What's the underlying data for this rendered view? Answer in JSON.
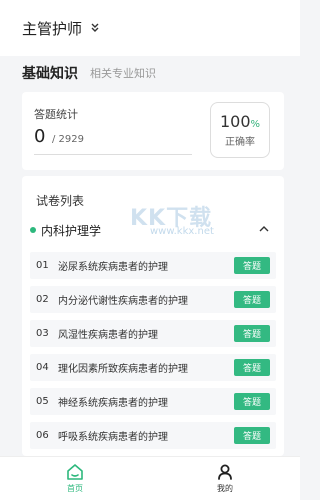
{
  "header": {
    "title": "主管护师",
    "dropdown_icon": "chevron-double-down-icon"
  },
  "tabs": {
    "active": "基础知识",
    "inactive": "相关专业知识"
  },
  "stats": {
    "label": "答题统计",
    "answered": "0",
    "total": "/ 2929",
    "rate_value": "100",
    "rate_unit": "%",
    "rate_label": "正确率"
  },
  "paper_list": {
    "title": "试卷列表",
    "category": "内科护理学",
    "category_expanded": true,
    "action_label": "答题",
    "items": [
      {
        "num": "01",
        "title": "泌尿系统疾病患者的护理"
      },
      {
        "num": "02",
        "title": "内分泌代谢性疾病患者的护理"
      },
      {
        "num": "03",
        "title": "风湿性疾病患者的护理"
      },
      {
        "num": "04",
        "title": "理化因素所致疾病患者的护理"
      },
      {
        "num": "05",
        "title": "神经系统疾病患者的护理"
      },
      {
        "num": "06",
        "title": "呼吸系统疾病患者的护理"
      }
    ]
  },
  "watermark": {
    "text": "KK下载",
    "url": "www.kkx.net"
  },
  "bottom_nav": {
    "home": "首页",
    "me": "我的"
  },
  "colors": {
    "accent": "#2db87d",
    "button": "#33b982"
  }
}
